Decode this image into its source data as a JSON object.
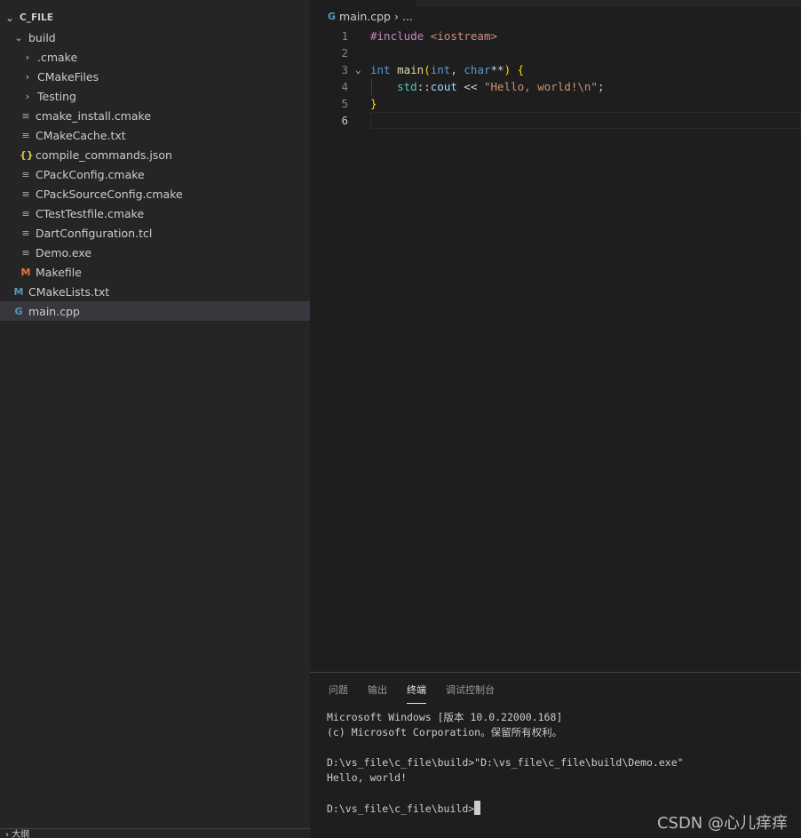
{
  "explorer": {
    "root": "C_FILE",
    "items": [
      {
        "label": "build",
        "kind": "folder-open",
        "depth": 1
      },
      {
        "label": ".cmake",
        "kind": "folder",
        "depth": 2
      },
      {
        "label": "CMakeFiles",
        "kind": "folder",
        "depth": 2
      },
      {
        "label": "Testing",
        "kind": "folder",
        "depth": 2
      },
      {
        "label": "cmake_install.cmake",
        "kind": "lines-icon",
        "depth": 2
      },
      {
        "label": "CMakeCache.txt",
        "kind": "lines-icon",
        "depth": 2
      },
      {
        "label": "compile_commands.json",
        "kind": "json-braces-icon",
        "depth": 2
      },
      {
        "label": "CPackConfig.cmake",
        "kind": "lines-icon",
        "depth": 2
      },
      {
        "label": "CPackSourceConfig.cmake",
        "kind": "lines-icon",
        "depth": 2
      },
      {
        "label": "CTestTestfile.cmake",
        "kind": "lines-icon",
        "depth": 2
      },
      {
        "label": "DartConfiguration.tcl",
        "kind": "lines-icon",
        "depth": 2
      },
      {
        "label": "Demo.exe",
        "kind": "lines-icon",
        "depth": 2
      },
      {
        "label": "Makefile",
        "kind": "makefile-icon",
        "depth": 2
      },
      {
        "label": "CMakeLists.txt",
        "kind": "cmake-icon",
        "depth": 1
      },
      {
        "label": "main.cpp",
        "kind": "cpp-icon",
        "depth": 1,
        "selected": true
      }
    ],
    "outline": "大纲"
  },
  "editor": {
    "breadcrumb_file": "main.cpp",
    "breadcrumb_more": "...",
    "active_line": 6,
    "lines": [
      "#include <iostream>",
      "",
      "int main(int, char**) {",
      "    std::cout << \"Hello, world!\\n\";",
      "}",
      ""
    ]
  },
  "panel": {
    "tabs": [
      "问题",
      "输出",
      "终端",
      "调试控制台"
    ],
    "active_tab": "终端",
    "terminal_lines": [
      "Microsoft Windows [版本 10.0.22000.168]",
      "(c) Microsoft Corporation。保留所有权利。",
      "",
      "D:\\vs_file\\c_file\\build>\"D:\\vs_file\\c_file\\build\\Demo.exe\"",
      "Hello, world!",
      "",
      "D:\\vs_file\\c_file\\build>"
    ]
  },
  "watermark": "CSDN @心儿痒痒"
}
